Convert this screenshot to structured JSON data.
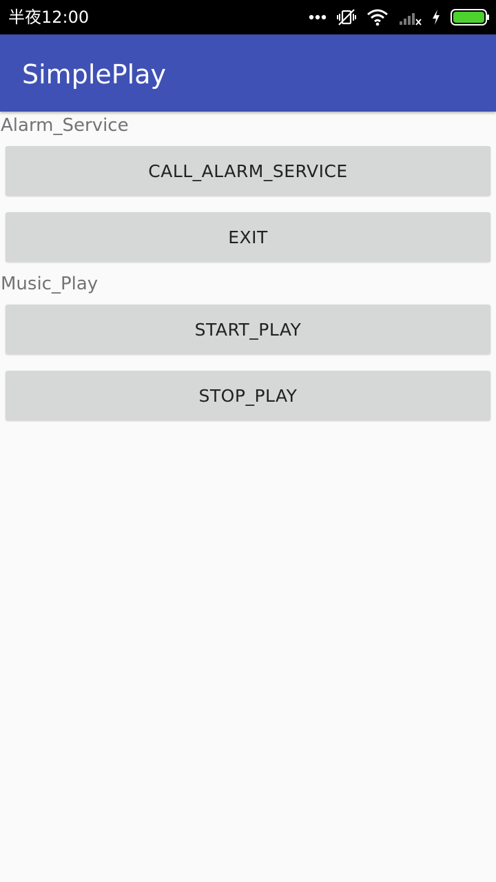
{
  "status_bar": {
    "time": "半夜12:00",
    "icons": [
      "more-dots-icon",
      "vibrate-off-icon",
      "wifi-icon",
      "signal-icon",
      "charging-icon",
      "battery-icon"
    ],
    "battery_color": "#4cd12f"
  },
  "app_bar": {
    "title": "SimplePlay",
    "color": "#3f51b5"
  },
  "sections": [
    {
      "label": "Alarm_Service",
      "buttons": [
        "CALL_ALARM_SERVICE",
        "EXIT"
      ]
    },
    {
      "label": "Music_Play",
      "buttons": [
        "START_PLAY",
        "STOP_PLAY"
      ]
    }
  ]
}
